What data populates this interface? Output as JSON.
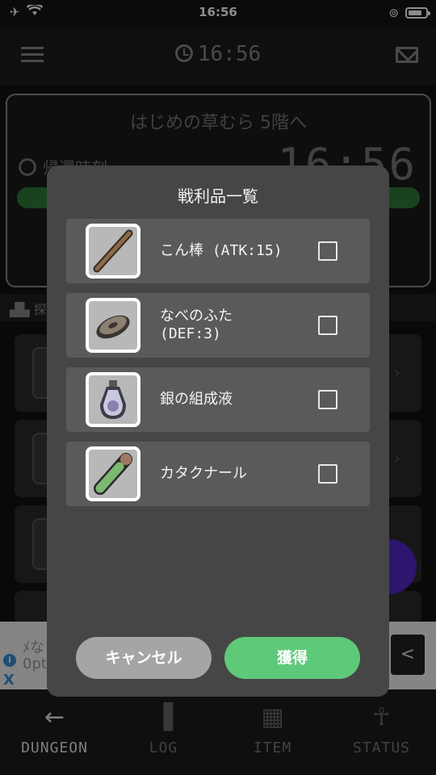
{
  "status_bar": {
    "time": "16:56"
  },
  "header": {
    "clock_time": "16:56"
  },
  "dungeon": {
    "title": "はじめの草むら 5階へ",
    "return_label": "帰還時刻",
    "return_time": "16:56",
    "progress_fraction": 1.0
  },
  "log_section": {
    "label": "探"
  },
  "ad": {
    "text_line1": "ﾒな",
    "text_line2": "0pt",
    "info_icon": "i",
    "close_icon": "X",
    "back_icon": "<"
  },
  "nav": {
    "items": [
      {
        "label": "DUNGEON",
        "icon": "arrow-left-icon",
        "glyph": "←"
      },
      {
        "label": "LOG",
        "icon": "book-icon",
        "glyph": "▐"
      },
      {
        "label": "ITEM",
        "icon": "grid-icon",
        "glyph": "▦"
      },
      {
        "label": "STATUS",
        "icon": "person-icon",
        "glyph": "☥"
      }
    ],
    "active": "DUNGEON"
  },
  "modal": {
    "title": "戦利品一覧",
    "items": [
      {
        "name": "こん棒 (ATK:15)",
        "icon": "club-icon",
        "checked": false
      },
      {
        "name": "なべのふた\n(DEF:3)",
        "icon": "pot-lid-icon",
        "checked": false
      },
      {
        "name": "銀の組成液",
        "icon": "silver-potion-icon",
        "checked": false
      },
      {
        "name": "カタクナール",
        "icon": "green-vial-icon",
        "checked": false
      }
    ],
    "cancel_label": "キャンセル",
    "get_label": "獲得"
  },
  "colors": {
    "accent_green": "#5fc97a",
    "cancel_gray": "#a5a5a5",
    "fab_purple": "#5028c8"
  }
}
